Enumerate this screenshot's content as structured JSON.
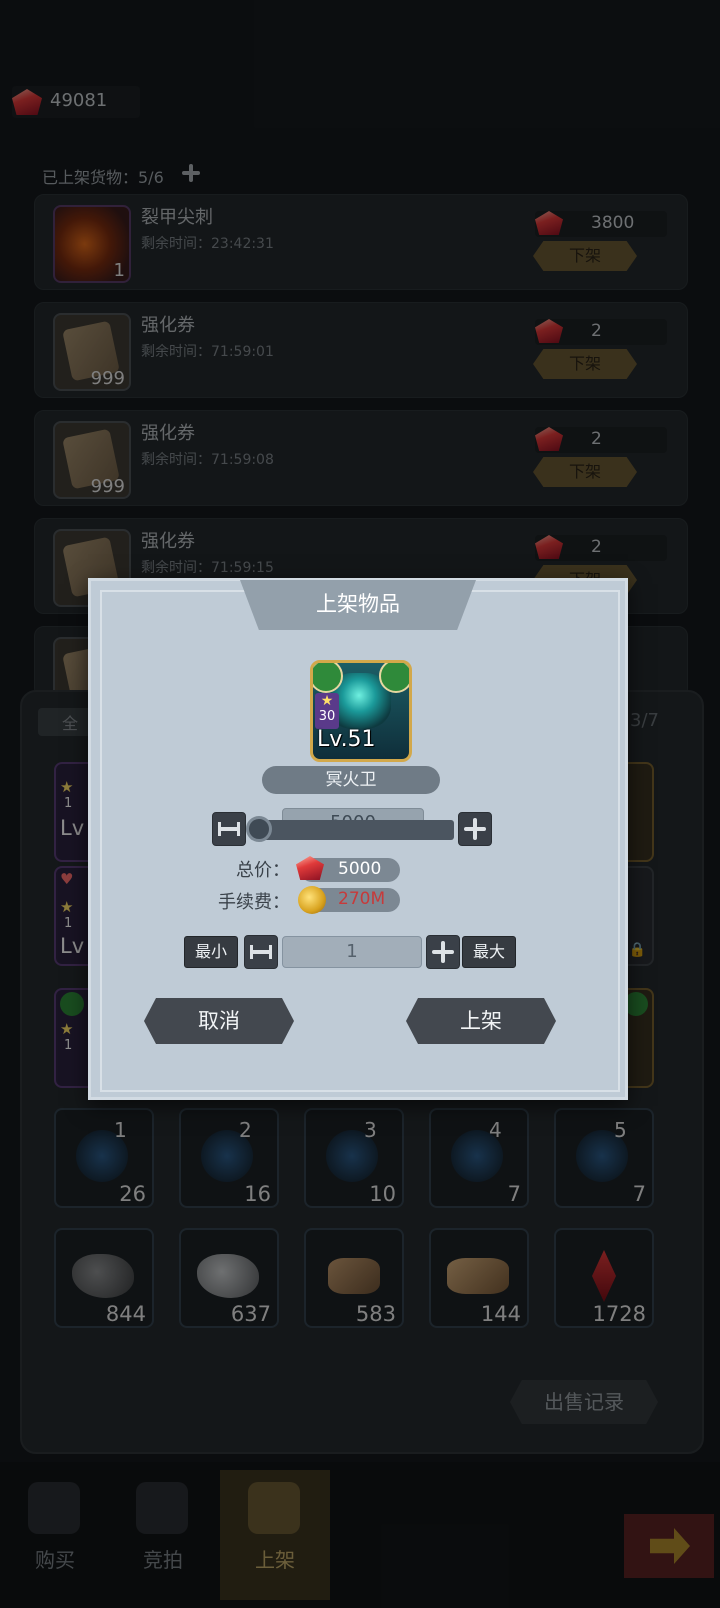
{
  "top_bar": {
    "gem_balance": "49081"
  },
  "listed": {
    "title": "已上架货物：5/6",
    "items": [
      {
        "name": "裂甲尖刺",
        "time": "剩余时间：23:42:31",
        "count": "1",
        "price": "3800",
        "delist_label": "下架"
      },
      {
        "name": "强化券",
        "time": "剩余时间：71:59:01",
        "count": "999",
        "price": "2",
        "delist_label": "下架"
      },
      {
        "name": "强化券",
        "time": "剩余时间：71:59:08",
        "count": "999",
        "price": "2",
        "delist_label": "下架"
      },
      {
        "name": "强化券",
        "time": "剩余时间：71:59:15",
        "count": "",
        "price": "2",
        "delist_label": "下架"
      }
    ]
  },
  "inventory": {
    "tab_all": "全",
    "count": "3/7",
    "slot_level_1": "1",
    "slot_level_prefix": "Lv",
    "runes": [
      {
        "tier": "1",
        "count": "26"
      },
      {
        "tier": "2",
        "count": "16"
      },
      {
        "tier": "3",
        "count": "10"
      },
      {
        "tier": "4",
        "count": "7"
      },
      {
        "tier": "5",
        "count": "7"
      }
    ],
    "materials": [
      {
        "count": "844"
      },
      {
        "count": "637"
      },
      {
        "count": "583"
      },
      {
        "count": "144"
      },
      {
        "count": "1728"
      }
    ],
    "sale_record_label": "出售记录"
  },
  "nav": {
    "buy": "购买",
    "auction": "竞拍",
    "list": "上架"
  },
  "modal": {
    "title": "上架物品",
    "hero": {
      "stars": "30",
      "level": "Lv.51",
      "name": "冥火卫"
    },
    "unit_price": "5000",
    "slider_fraction": 0.0,
    "total_label": "总价：",
    "total_value": "5000",
    "fee_label": "手续费：",
    "fee_value": "270M",
    "min_label": "最小",
    "max_label": "最大",
    "quantity": "1",
    "cancel_label": "取消",
    "confirm_label": "上架"
  }
}
